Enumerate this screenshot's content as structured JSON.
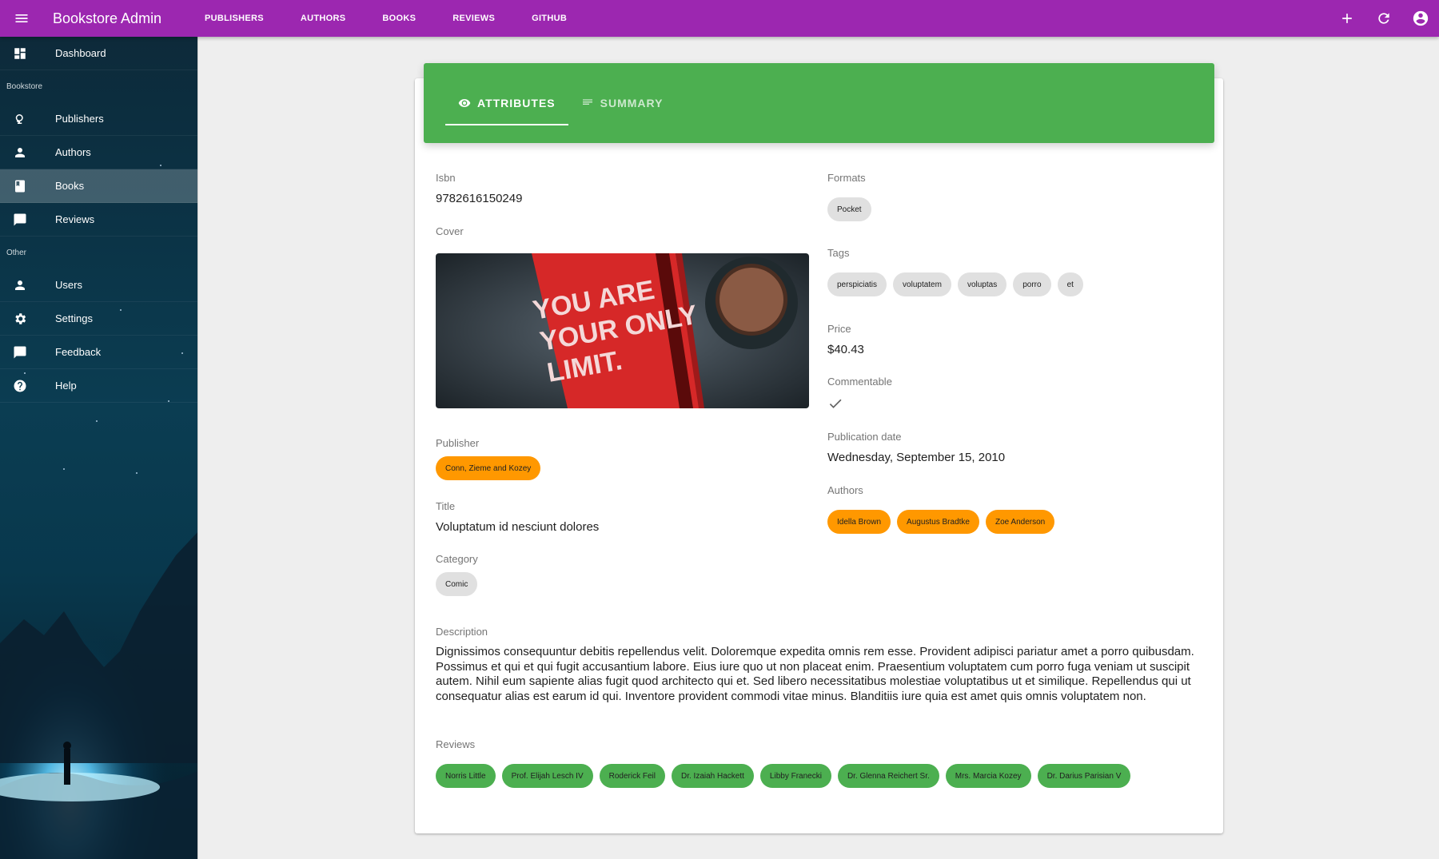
{
  "appbar": {
    "title": "Bookstore Admin",
    "nav": [
      "PUBLISHERS",
      "AUTHORS",
      "BOOKS",
      "REVIEWS",
      "GITHUB"
    ],
    "color": "#9c27b0"
  },
  "sidebar": {
    "dashboard": "Dashboard",
    "section_bookstore": "Bookstore",
    "publishers": "Publishers",
    "authors": "Authors",
    "books": "Books",
    "reviews": "Reviews",
    "section_other": "Other",
    "users": "Users",
    "settings": "Settings",
    "feedback": "Feedback",
    "help": "Help",
    "active": "Books"
  },
  "tabs": {
    "attributes": "ATTRIBUTES",
    "summary": "SUMMARY",
    "color": "#4caf50"
  },
  "book": {
    "isbn_label": "Isbn",
    "isbn": "9782616150249",
    "cover_label": "Cover",
    "cover_text": "YOU ARE YOUR ONLY LIMIT.",
    "publisher_label": "Publisher",
    "publisher": "Conn, Zieme and Kozey",
    "title_label": "Title",
    "title": "Voluptatum id nesciunt dolores",
    "category_label": "Category",
    "category": "Comic",
    "formats_label": "Formats",
    "formats": [
      "Pocket"
    ],
    "tags_label": "Tags",
    "tags": [
      "perspiciatis",
      "voluptatem",
      "voluptas",
      "porro",
      "et"
    ],
    "price_label": "Price",
    "price": "$40.43",
    "commentable_label": "Commentable",
    "commentable": true,
    "publication_date_label": "Publication date",
    "publication_date": "Wednesday, September 15, 2010",
    "authors_label": "Authors",
    "authors": [
      "Idella Brown",
      "Augustus Bradtke",
      "Zoe Anderson"
    ],
    "description_label": "Description",
    "description": "Dignissimos consequuntur debitis repellendus velit. Doloremque expedita omnis rem esse. Provident adipisci pariatur amet a porro quibusdam. Possimus et qui et qui fugit accusantium labore. Eius iure quo ut non placeat enim. Praesentium voluptatem cum porro fuga veniam ut suscipit autem. Nihil eum sapiente alias fugit quod architecto qui et. Sed libero necessitatibus molestiae voluptatibus ut et similique. Repellendus qui ut consequatur alias est earum id qui. Inventore provident commodi vitae minus. Blanditiis iure quia est amet quis omnis voluptatem non.",
    "reviews_label": "Reviews",
    "reviews": [
      "Norris Little",
      "Prof. Elijah Lesch IV",
      "Roderick Feil",
      "Dr. Izaiah Hackett",
      "Libby Franecki",
      "Dr. Glenna Reichert Sr.",
      "Mrs. Marcia Kozey",
      "Dr. Darius Parisian V"
    ]
  }
}
